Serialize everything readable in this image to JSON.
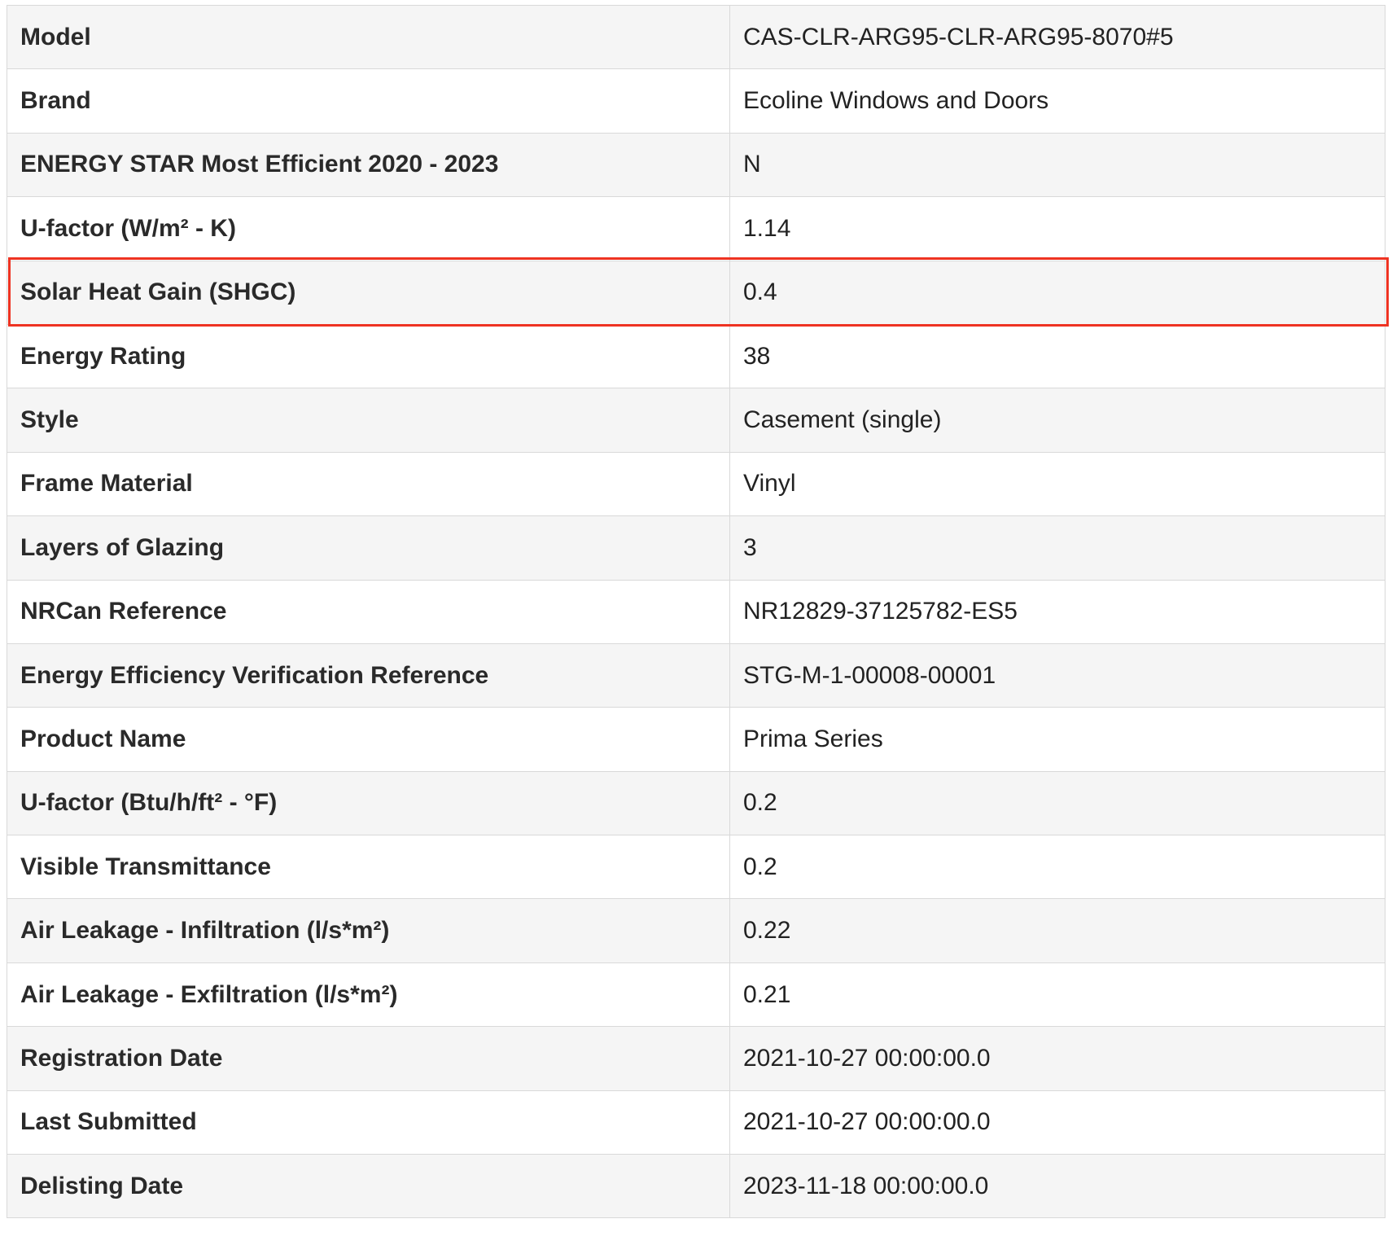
{
  "rows": [
    {
      "label": "Model",
      "value": "CAS-CLR-ARG95-CLR-ARG95-8070#5"
    },
    {
      "label": "Brand",
      "value": "Ecoline Windows and Doors"
    },
    {
      "label": "ENERGY STAR Most Efficient 2020 - 2023",
      "value": "N"
    },
    {
      "label": "U-factor (W/m² - K)",
      "value": "1.14"
    },
    {
      "label": "Solar Heat Gain (SHGC)",
      "value": "0.4"
    },
    {
      "label": "Energy Rating",
      "value": "38"
    },
    {
      "label": "Style",
      "value": "Casement (single)"
    },
    {
      "label": "Frame Material",
      "value": "Vinyl"
    },
    {
      "label": "Layers of Glazing",
      "value": "3"
    },
    {
      "label": "NRCan Reference",
      "value": "NR12829-37125782-ES5"
    },
    {
      "label": "Energy Efficiency Verification Reference",
      "value": "STG-M-1-00008-00001"
    },
    {
      "label": "Product Name",
      "value": "Prima Series"
    },
    {
      "label": "U-factor (Btu/h/ft² - °F)",
      "value": "0.2"
    },
    {
      "label": "Visible Transmittance",
      "value": "0.2"
    },
    {
      "label": "Air Leakage - Infiltration (l/s*m²)",
      "value": "0.22"
    },
    {
      "label": "Air Leakage - Exfiltration (l/s*m²)",
      "value": "0.21"
    },
    {
      "label": "Registration Date",
      "value": "2021-10-27 00:00:00.0"
    },
    {
      "label": "Last Submitted",
      "value": "2021-10-27 00:00:00.0"
    },
    {
      "label": "Delisting Date",
      "value": "2023-11-18 00:00:00.0"
    }
  ],
  "highlight": {
    "row_index": 4,
    "color": "#ee3322"
  }
}
